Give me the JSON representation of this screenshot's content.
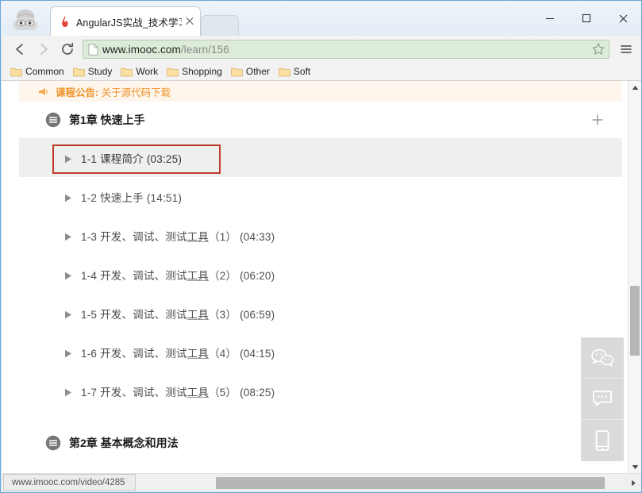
{
  "browser": {
    "profile_icon": "incognito-icon",
    "tab": {
      "favicon": "flame-icon",
      "title": "AngularJS实战_技术学习教",
      "close_label": "×"
    },
    "window_controls": {
      "minimize": "minimize-icon",
      "maximize": "maximize-icon",
      "close": "close-icon"
    },
    "toolbar": {
      "back": "back-arrow-icon",
      "forward": "forward-arrow-icon",
      "reload": "reload-icon",
      "page_icon": "page-document-icon",
      "url_host": "www.imooc.com",
      "url_path": "/learn/156",
      "url_full": "www.imooc.com/learn/156",
      "bookmark_star": "star-icon",
      "menu": "hamburger-menu-icon"
    },
    "bookmarks": [
      {
        "label": "Common",
        "icon": "folder-icon"
      },
      {
        "label": "Study",
        "icon": "folder-icon"
      },
      {
        "label": "Work",
        "icon": "folder-icon"
      },
      {
        "label": "Shopping",
        "icon": "folder-icon"
      },
      {
        "label": "Other",
        "icon": "folder-icon"
      },
      {
        "label": "Soft",
        "icon": "folder-icon"
      }
    ],
    "status_bar": {
      "url": "www.imooc.com/video/4285"
    }
  },
  "page": {
    "announcement": {
      "icon": "megaphone-icon",
      "label": "课程公告:",
      "text": " 关于源代码下载",
      "color": "#f0932b",
      "background": "#fef6ec"
    },
    "chapters": [
      {
        "icon": "list-circle-icon",
        "title": "第1章 快速上手",
        "expand_icon": "plus-icon",
        "lessons": [
          {
            "num": "1-1",
            "name_a": "课程简介",
            "name_u": "",
            "name_b": "",
            "time": "(03:25)",
            "active": true
          },
          {
            "num": "1-2",
            "name_a": "快速上手",
            "name_u": "",
            "name_b": "",
            "time": "(14:51)",
            "active": false
          },
          {
            "num": "1-3",
            "name_a": "开发、调试、测试",
            "name_u": "工具",
            "name_b": "（1）",
            "time": "(04:33)",
            "active": false
          },
          {
            "num": "1-4",
            "name_a": "开发、调试、测试",
            "name_u": "工具",
            "name_b": "（2）",
            "time": "(06:20)",
            "active": false
          },
          {
            "num": "1-5",
            "name_a": "开发、调试、测试",
            "name_u": "工具",
            "name_b": "（3）",
            "time": "(06:59)",
            "active": false
          },
          {
            "num": "1-6",
            "name_a": "开发、调试、测试",
            "name_u": "工具",
            "name_b": "（4）",
            "time": "(04:15)",
            "active": false
          },
          {
            "num": "1-7",
            "name_a": "开发、调试、测试",
            "name_u": "工具",
            "name_b": "（5）",
            "time": "(08:25)",
            "active": false
          }
        ]
      },
      {
        "icon": "list-circle-icon",
        "title": "第2章 基本概念和用法",
        "expand_icon": "",
        "lessons": []
      }
    ],
    "side_widget": [
      {
        "icon": "wechat-icon"
      },
      {
        "icon": "feedback-chat-icon"
      },
      {
        "icon": "mobile-app-icon"
      }
    ],
    "annotation": {
      "target": "1-1 课程简介 (03:25)",
      "color": "#c0392b"
    }
  }
}
